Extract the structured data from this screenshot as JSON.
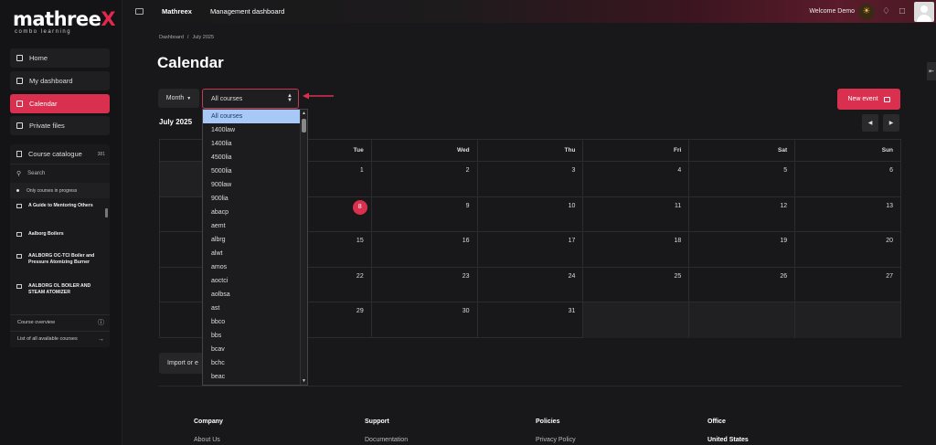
{
  "brand": {
    "name_main": "mathree",
    "name_x": "X",
    "tagline": "combo learning"
  },
  "sidebar": {
    "nav": [
      {
        "label": "Home",
        "active": false
      },
      {
        "label": "My dashboard",
        "active": false
      },
      {
        "label": "Calendar",
        "active": true
      },
      {
        "label": "Private files",
        "active": false
      }
    ],
    "catalogue": {
      "title": "Course catalogue",
      "count": "381",
      "search_placeholder": "Search",
      "filter": "Only courses in progress",
      "courses": [
        "A Guide to Mentoring Others",
        "Aalborg Boilers",
        "AALBORG OC-TCI Boiler and Pressure Atomizing Burner",
        "AALBORG OL BOILER AND STEAM ATOMIZER"
      ],
      "overview": "Course overview",
      "all_courses": "List of all available courses"
    }
  },
  "topbar": {
    "site": "Mathreex",
    "dashboard": "Management dashboard",
    "welcome": "Welcome Demo"
  },
  "main": {
    "breadcrumb": [
      "Dashboard",
      "July 2025"
    ],
    "title": "Calendar",
    "view_button": "Month",
    "course_select": "All courses",
    "new_event": "New event",
    "month_label": "July 2025",
    "weekdays": [
      "",
      "Tue",
      "Wed",
      "Thu",
      "Fri",
      "Sat",
      "Sun"
    ],
    "weeks": [
      [
        "",
        "1",
        "2",
        "3",
        "4",
        "5",
        "6"
      ],
      [
        "",
        "8",
        "9",
        "10",
        "11",
        "12",
        "13"
      ],
      [
        "",
        "15",
        "16",
        "17",
        "18",
        "19",
        "20"
      ],
      [
        "",
        "22",
        "23",
        "24",
        "25",
        "26",
        "27"
      ],
      [
        "",
        "29",
        "30",
        "31",
        "",
        "",
        ""
      ]
    ],
    "today": "8",
    "import_button": "Import or e"
  },
  "dropdown": {
    "options": [
      "All courses",
      "1400law",
      "1400lia",
      "4500lia",
      "5000lia",
      "900law",
      "900lia",
      "abacp",
      "aemt",
      "albrg",
      "alwt",
      "amos",
      "aoctci",
      "aolbsa",
      "ast",
      "bbco",
      "bbs",
      "bcav",
      "bchc",
      "beac"
    ]
  },
  "footer": {
    "columns": [
      {
        "heading": "Company",
        "link": "About Us"
      },
      {
        "heading": "Support",
        "link": "Documentation"
      },
      {
        "heading": "Policies",
        "link": "Privacy Policy"
      },
      {
        "heading": "Office",
        "link": "United States"
      }
    ]
  }
}
